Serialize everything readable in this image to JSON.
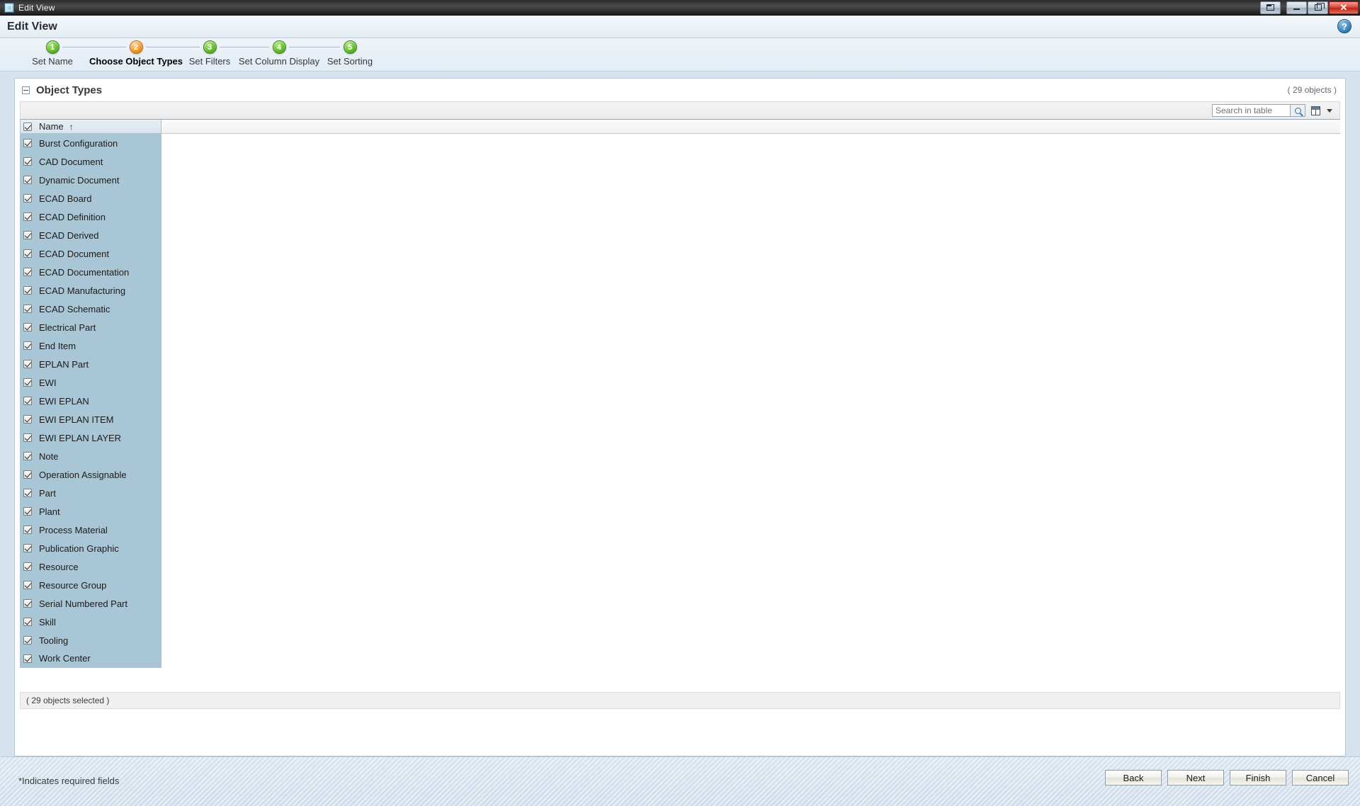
{
  "window": {
    "title": "Edit View",
    "icon": "window-icon",
    "controls": {
      "restore_down": "restore-down",
      "minimize": "minimize",
      "maximize": "maximize",
      "close": "✕"
    }
  },
  "header": {
    "title": "Edit View",
    "help_label": "?"
  },
  "wizard": {
    "steps": [
      {
        "number": "1",
        "label": "Set Name",
        "state": "complete"
      },
      {
        "number": "2",
        "label": "Choose Object Types",
        "state": "current"
      },
      {
        "number": "3",
        "label": "Set Filters",
        "state": "complete"
      },
      {
        "number": "4",
        "label": "Set Column Display",
        "state": "complete"
      },
      {
        "number": "5",
        "label": "Set Sorting",
        "state": "complete"
      }
    ]
  },
  "panel": {
    "title": "Object Types",
    "object_count": "( 29 objects )",
    "selected_count": "( 29 objects selected )"
  },
  "toolbar": {
    "search_value": "",
    "search_placeholder": "Search in table",
    "search_icon": "magnifier-icon",
    "grid_icon": "table-view-icon",
    "caret_icon": "chevron-down-icon"
  },
  "table": {
    "header_checkbox_checked": true,
    "columns": [
      {
        "label": "Name",
        "sort": "↑"
      }
    ],
    "rows": [
      {
        "label": "Burst Configuration",
        "checked": true
      },
      {
        "label": "CAD Document",
        "checked": true
      },
      {
        "label": "Dynamic Document",
        "checked": true
      },
      {
        "label": "ECAD Board",
        "checked": true
      },
      {
        "label": "ECAD Definition",
        "checked": true
      },
      {
        "label": "ECAD Derived",
        "checked": true
      },
      {
        "label": "ECAD Document",
        "checked": true
      },
      {
        "label": "ECAD Documentation",
        "checked": true
      },
      {
        "label": "ECAD Manufacturing",
        "checked": true
      },
      {
        "label": "ECAD Schematic",
        "checked": true
      },
      {
        "label": "Electrical Part",
        "checked": true
      },
      {
        "label": "End Item",
        "checked": true
      },
      {
        "label": "EPLAN Part",
        "checked": true
      },
      {
        "label": "EWI",
        "checked": true
      },
      {
        "label": "EWI EPLAN",
        "checked": true
      },
      {
        "label": "EWI EPLAN ITEM",
        "checked": true
      },
      {
        "label": "EWI EPLAN LAYER",
        "checked": true
      },
      {
        "label": "Note",
        "checked": true
      },
      {
        "label": "Operation Assignable",
        "checked": true
      },
      {
        "label": "Part",
        "checked": true
      },
      {
        "label": "Plant",
        "checked": true
      },
      {
        "label": "Process Material",
        "checked": true
      },
      {
        "label": "Publication Graphic",
        "checked": true
      },
      {
        "label": "Resource",
        "checked": true
      },
      {
        "label": "Resource Group",
        "checked": true
      },
      {
        "label": "Serial Numbered Part",
        "checked": true
      },
      {
        "label": "Skill",
        "checked": true
      },
      {
        "label": "Tooling",
        "checked": true
      },
      {
        "label": "Work Center",
        "checked": true
      }
    ]
  },
  "footer": {
    "required_note": "*Indicates required fields",
    "buttons": [
      {
        "label": "Back"
      },
      {
        "label": "Next"
      },
      {
        "label": "Finish"
      },
      {
        "label": "Cancel"
      }
    ]
  },
  "colors": {
    "selection_row": "#a9c6d6",
    "step_current": "#f0931f",
    "step_complete": "#5cb82a",
    "close_button": "#bc2718"
  }
}
